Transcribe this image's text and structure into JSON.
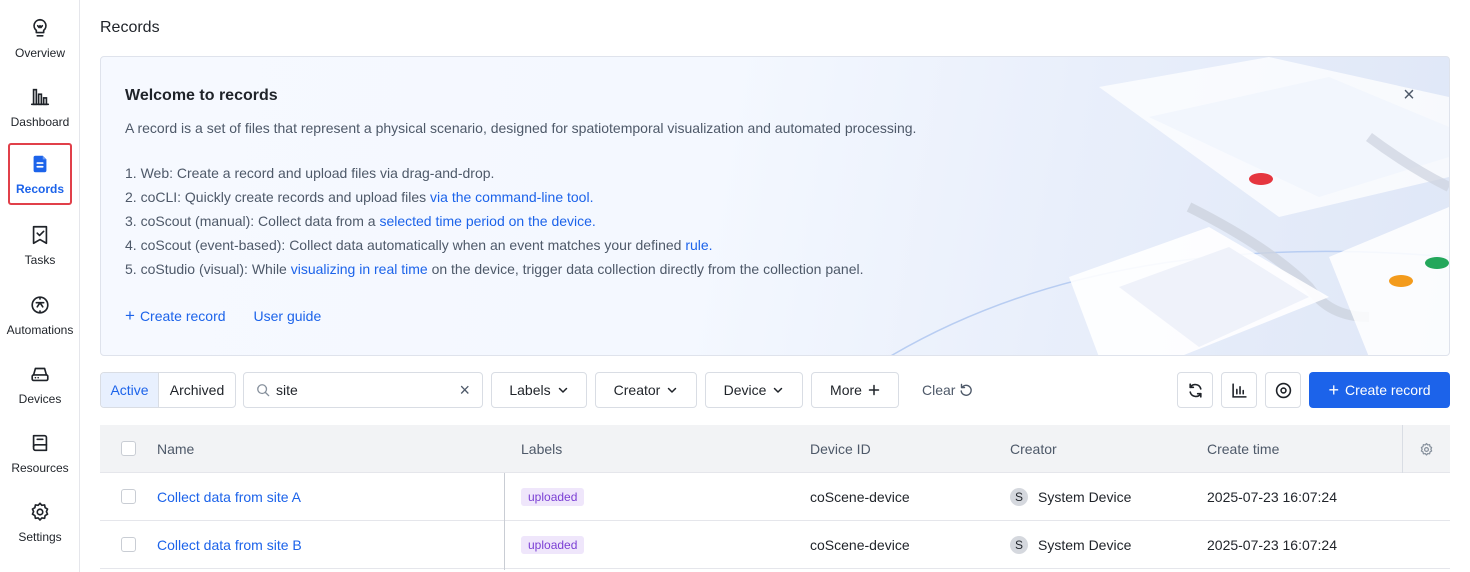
{
  "sidebar": {
    "items": [
      {
        "label": "Overview",
        "icon": "lightbulb-icon"
      },
      {
        "label": "Dashboard",
        "icon": "bar-chart-icon"
      },
      {
        "label": "Records",
        "icon": "records-icon",
        "active": true
      },
      {
        "label": "Tasks",
        "icon": "tasks-icon"
      },
      {
        "label": "Automations",
        "icon": "automations-icon"
      },
      {
        "label": "Devices",
        "icon": "device-icon"
      },
      {
        "label": "Resources",
        "icon": "book-icon"
      },
      {
        "label": "Settings",
        "icon": "gear-icon"
      }
    ]
  },
  "page": {
    "title": "Records"
  },
  "banner": {
    "title": "Welcome to records",
    "description": "A record is a set of files that represent a physical scenario, designed for spatiotemporal visualization and automated processing.",
    "steps": [
      {
        "text": "1. Web: Create a record and upload files via drag-and-drop.",
        "link": ""
      },
      {
        "text": "2. coCLI: Quickly create records and upload files ",
        "link": "via the command-line tool."
      },
      {
        "text": "3. coScout (manual): Collect data from a ",
        "link": "selected time period on the device."
      },
      {
        "text": "4. coScout (event-based): Collect data automatically when an event matches your defined ",
        "link": "rule."
      },
      {
        "text": "5. coStudio (visual): While ",
        "link": "visualizing in real time",
        "suffix": " on the device, trigger data collection directly from the collection panel."
      }
    ],
    "create_label": "Create record",
    "guide_label": "User guide",
    "close_symbol": "×"
  },
  "toolbar": {
    "active_label": "Active",
    "archived_label": "Archived",
    "search_value": "site",
    "labels_label": "Labels",
    "creator_label": "Creator",
    "device_label": "Device",
    "more_label": "More",
    "clear_label": "Clear",
    "create_label": "Create record"
  },
  "table": {
    "columns": [
      "Name",
      "Labels",
      "Device ID",
      "Creator",
      "Create time"
    ],
    "rows": [
      {
        "name": "Collect data from site A",
        "label": "uploaded",
        "device": "coScene-device",
        "creator_initial": "S",
        "creator": "System Device",
        "time": "2025-07-23 16:07:24"
      },
      {
        "name": "Collect data from site B",
        "label": "uploaded",
        "device": "coScene-device",
        "creator_initial": "S",
        "creator": "System Device",
        "time": "2025-07-23 16:07:24"
      }
    ]
  },
  "colors": {
    "accent": "#1c63ea",
    "active_outline": "#e1404a",
    "tag_text": "#7b3fd4",
    "tag_bg": "#efe6fb"
  }
}
